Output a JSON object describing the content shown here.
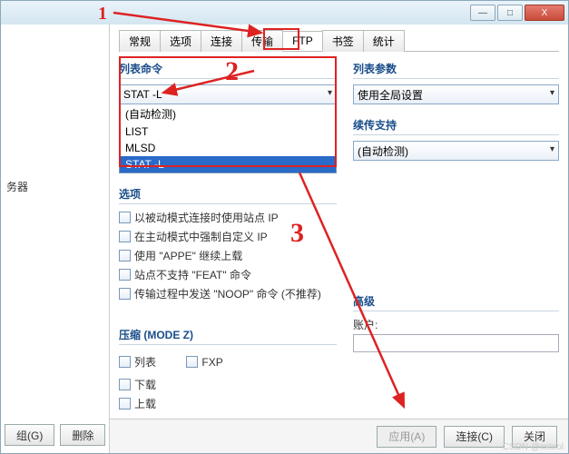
{
  "titlebar": {
    "min": "—",
    "max": "□",
    "close": "X"
  },
  "left": {
    "servers_label": "务器",
    "btn_group": "组(G)",
    "btn_delete": "删除"
  },
  "tabs": [
    {
      "id": "general",
      "label": "常规"
    },
    {
      "id": "options",
      "label": "选项"
    },
    {
      "id": "connect",
      "label": "连接"
    },
    {
      "id": "transfer",
      "label": "传输"
    },
    {
      "id": "ftp",
      "label": "FTP"
    },
    {
      "id": "bookmark",
      "label": "书签"
    },
    {
      "id": "stats",
      "label": "统计"
    }
  ],
  "list_cmd": {
    "title": "列表命令",
    "selected": "STAT -L",
    "options": [
      "(自动检测)",
      "LIST",
      "MLSD",
      "STAT -L"
    ]
  },
  "list_params": {
    "title": "列表参数",
    "selected": "使用全局设置"
  },
  "resume": {
    "title": "续传支持",
    "selected": "(自动检测)"
  },
  "options": {
    "title": "选项",
    "items": [
      "以被动模式连接时使用站点 IP",
      "在主动模式中强制自定义 IP",
      "使用 \"APPE\" 继续上载",
      "站点不支持 \"FEAT\" 命令",
      "传输过程中发送 \"NOOP\" 命令 (不推荐)"
    ]
  },
  "compress": {
    "title": "压缩 (MODE Z)",
    "items": [
      "列表",
      "下载",
      "上载"
    ],
    "fxp": "FXP"
  },
  "advanced": {
    "title": "高级",
    "account_label": "账户:",
    "account_value": ""
  },
  "footer": {
    "apply": "应用(A)",
    "connect": "连接(C)",
    "close": "关闭"
  },
  "annotations": {
    "n1": "1",
    "n2": "2",
    "n3": "3"
  },
  "watermark": "CSDN @xstool"
}
